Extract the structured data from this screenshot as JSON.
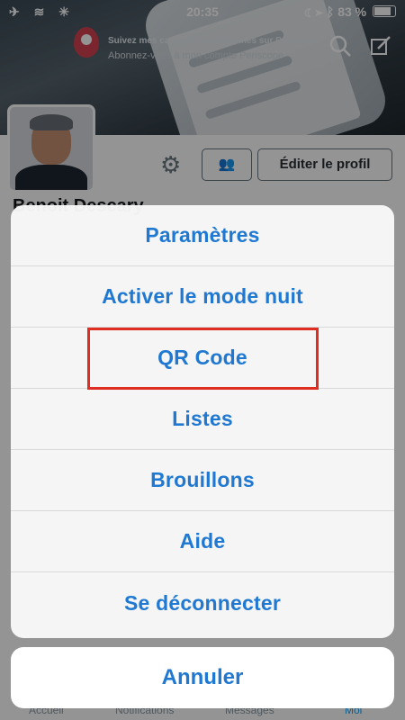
{
  "statusbar": {
    "time": "20:35",
    "battery": "83 %"
  },
  "banner": {
    "line1": "Suivez mes capsules quotidiennes sur Periscope",
    "line2": "Abonnez-vous à mon compte Periscope"
  },
  "profile": {
    "name": "Benoit Descary",
    "edit_label": "Éditer le profil"
  },
  "tabs": [
    "Accueil",
    "Notifications",
    "Messages",
    "Moi"
  ],
  "action_sheet": {
    "items": [
      "Paramètres",
      "Activer le mode nuit",
      "QR Code",
      "Listes",
      "Brouillons",
      "Aide",
      "Se déconnecter"
    ],
    "cancel_label": "Annuler"
  },
  "colors": {
    "accent": "#1f78d1",
    "highlight": "#e02d22"
  }
}
